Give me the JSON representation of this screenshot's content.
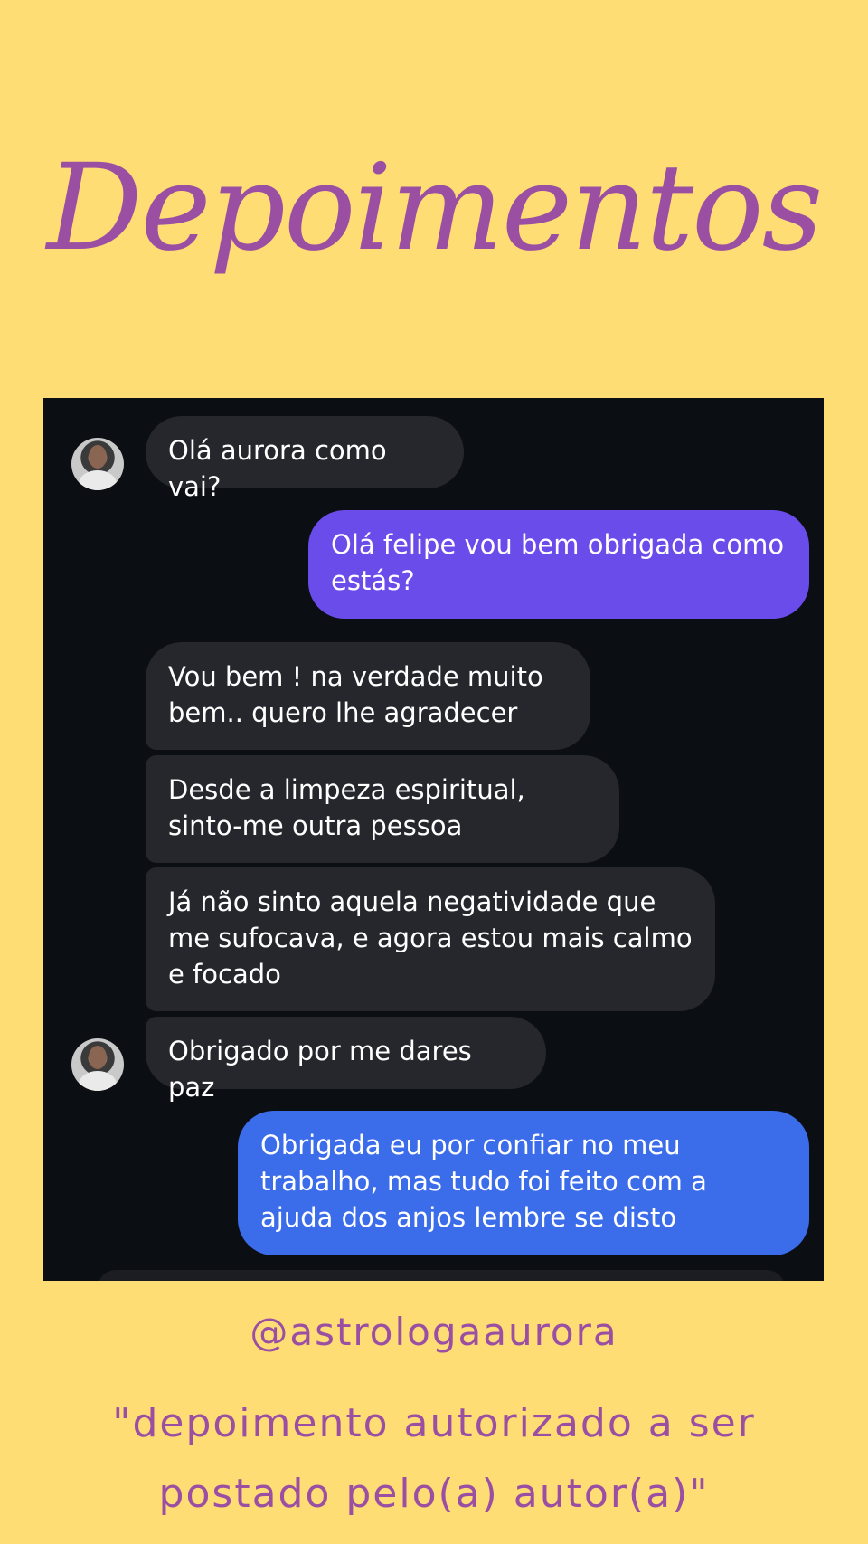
{
  "header": {
    "title": "Depoimentos"
  },
  "conversation": {
    "messages": [
      {
        "from": "contact",
        "text": "Olá aurora como vai?"
      },
      {
        "from": "me",
        "text": "Olá felipe vou bem obrigada como estás?"
      },
      {
        "from": "contact",
        "text": "Vou bem ! na verdade muito bem.. quero lhe agradecer"
      },
      {
        "from": "contact",
        "text": "Desde a limpeza espiritual, sinto-me outra pessoa"
      },
      {
        "from": "contact",
        "text": "Já não sinto aquela negatividade que me sufocava, e agora estou mais calmo e focado"
      },
      {
        "from": "contact",
        "text": "Obrigado por me dares paz"
      },
      {
        "from": "me",
        "text": "Obrigada eu por confiar no meu trabalho, mas tudo foi feito com a ajuda dos anjos lembre se disto"
      }
    ]
  },
  "footer": {
    "handle": "@astrologaaurora",
    "disclaimer_line1": "\"depoimento autorizado a ser",
    "disclaimer_line2": "postado pelo(a) autor(a)\""
  },
  "colors": {
    "background": "#FEDD74",
    "accent_text": "#9B4FA3",
    "chat_background": "#0B0E13",
    "incoming_bubble": "#25272C",
    "outgoing_bubble_1": "#6A4CEB",
    "outgoing_bubble_2": "#3B6CE9"
  },
  "icons": {
    "contact_avatar": "avatar"
  }
}
